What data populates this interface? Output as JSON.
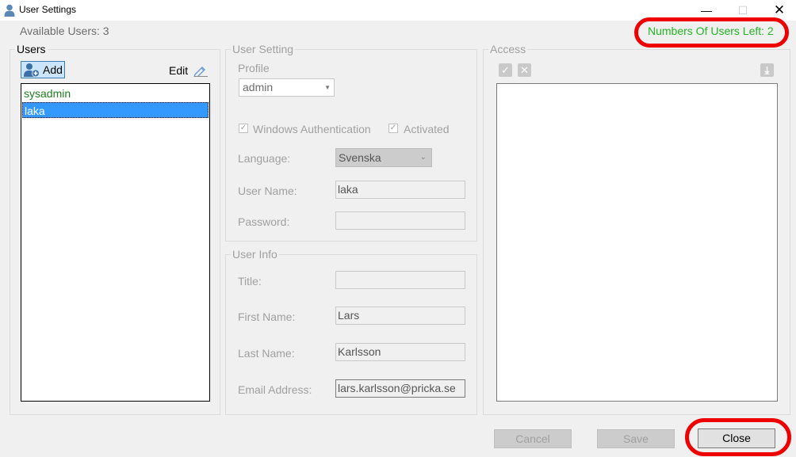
{
  "window": {
    "title": "User Settings",
    "min_glyph": "—",
    "max_glyph": "☐",
    "close_glyph": "✕"
  },
  "status": {
    "available_users": "Available Users: 3",
    "users_left": "Numbers Of Users Left: 2",
    "users_left_color": "#22b522",
    "highlight_color": "#ee0000"
  },
  "users_panel": {
    "legend": "Users",
    "add_label": "Add",
    "edit_label": "Edit",
    "items": [
      {
        "label": "sysadmin",
        "color": "#1e7f1e"
      },
      {
        "label": "laka",
        "selected": true
      }
    ]
  },
  "user_setting": {
    "legend": "User Setting",
    "profile_label": "Profile",
    "profile_value": "admin",
    "windows_auth_label": "Windows Authentication",
    "windows_auth_checked": true,
    "activated_label": "Activated",
    "activated_checked": true,
    "language_label": "Language:",
    "language_value": "Svenska",
    "username_label": "User Name:",
    "username_value": "laka",
    "password_label": "Password:",
    "password_value": ""
  },
  "user_info": {
    "legend": "User Info",
    "title_label": "Title:",
    "title_value": "",
    "firstname_label": "First Name:",
    "firstname_value": "Lars",
    "lastname_label": "Last Name:",
    "lastname_value": "Karlsson",
    "email_label": "Email Address:",
    "email_value": "lars.karlsson@pricka.se"
  },
  "access_panel": {
    "legend": "Access",
    "icons": [
      "check-all-icon",
      "uncheck-all-icon",
      "download-icon"
    ]
  },
  "buttons": {
    "cancel": "Cancel",
    "save": "Save",
    "close": "Close"
  }
}
